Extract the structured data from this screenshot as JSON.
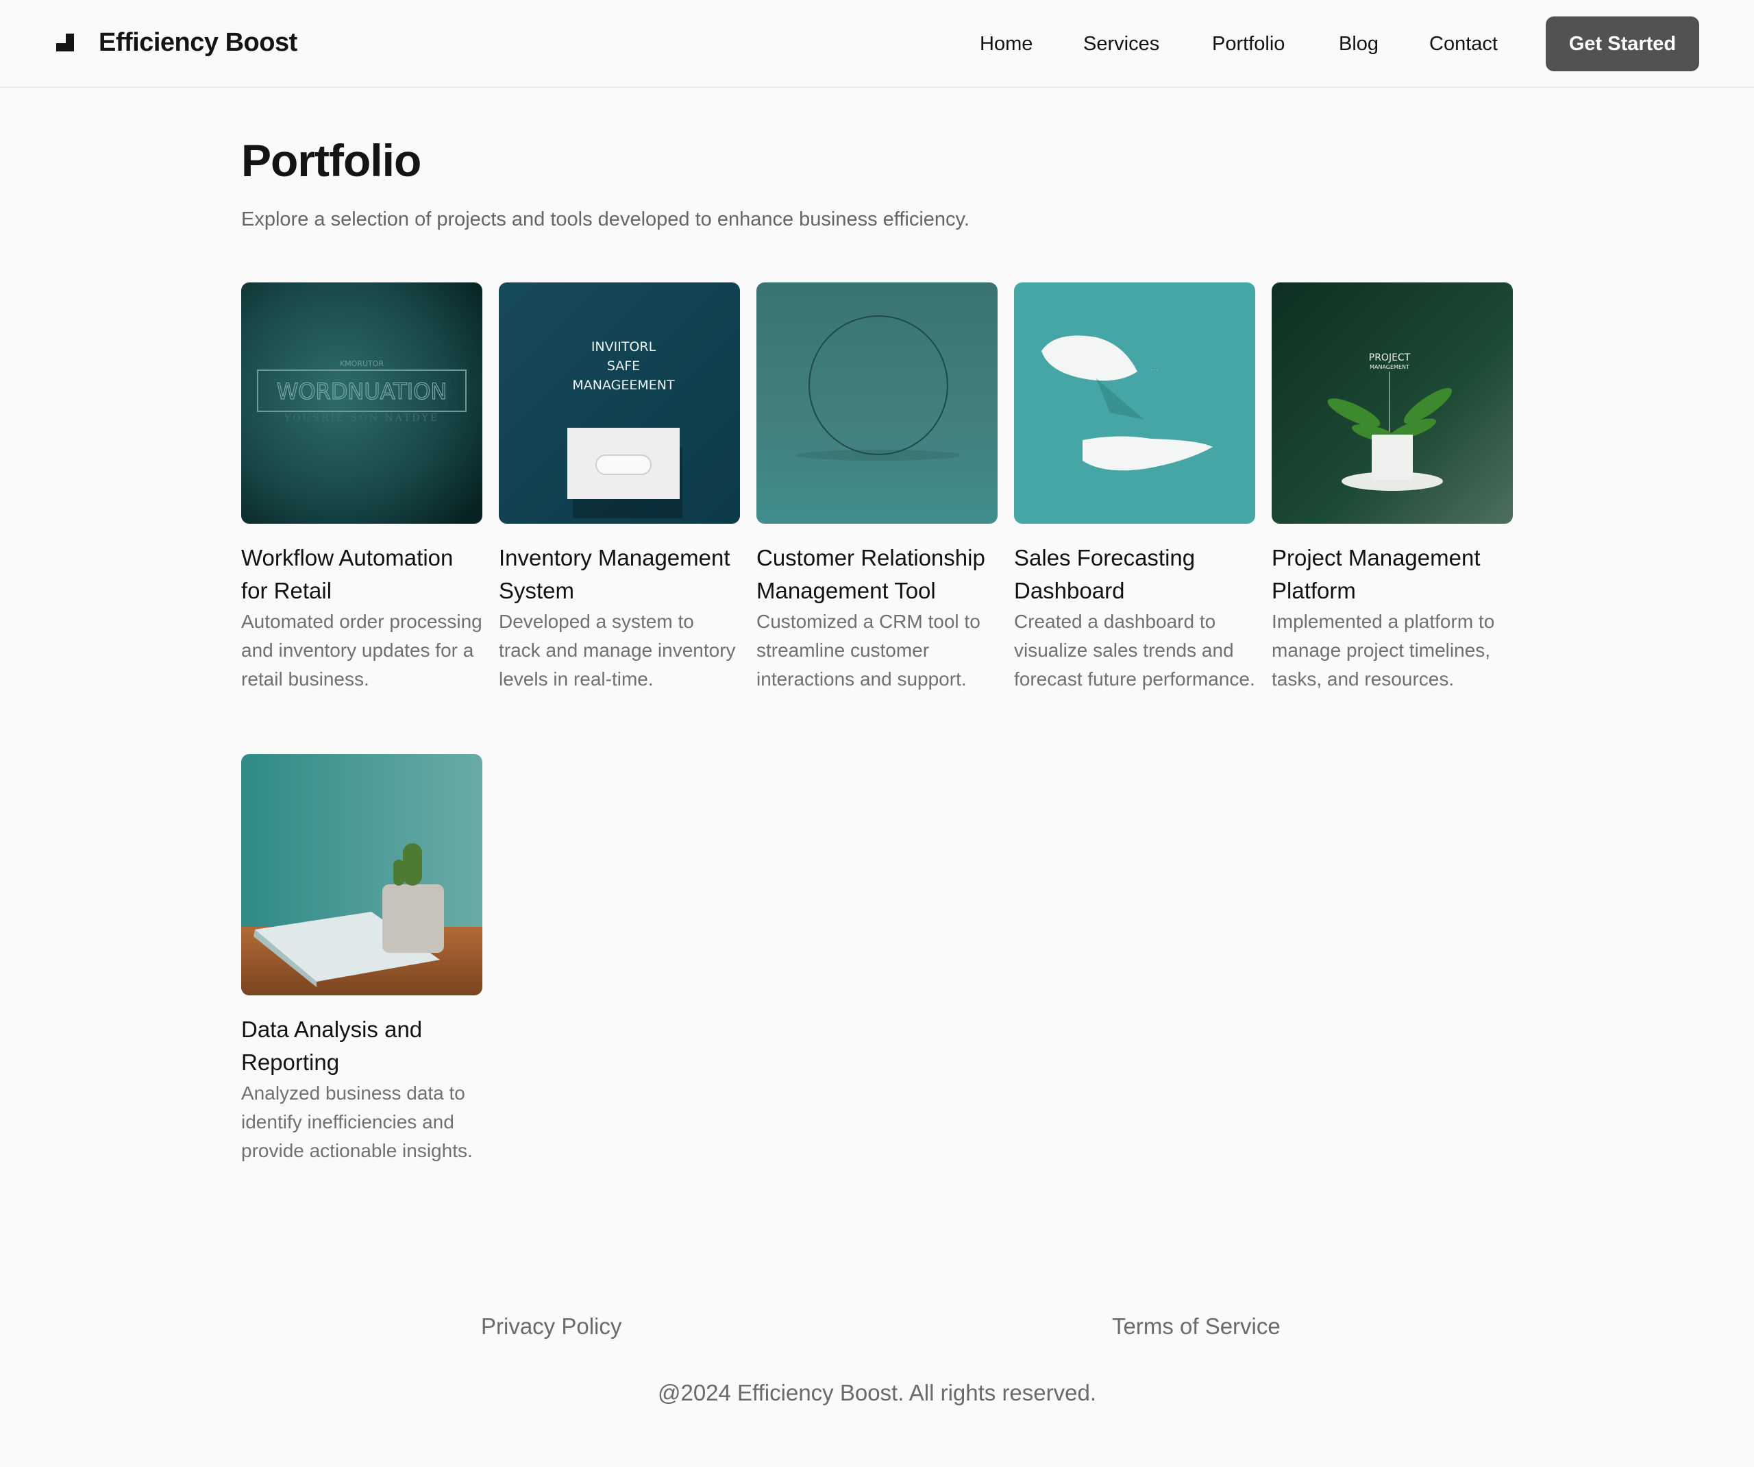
{
  "header": {
    "brand_name": "Efficiency Boost",
    "brand_icon": "stairs-logo-icon",
    "nav": [
      "Home",
      "Services",
      "Portfolio",
      "Blog",
      "Contact"
    ],
    "cta_label": "Get Started"
  },
  "main": {
    "title": "Portfolio",
    "subtitle": "Explore a selection of projects and tools developed to enhance business efficiency."
  },
  "projects": [
    {
      "title": "Workflow Automation for Retail",
      "description": "Automated order processing and inventory updates for a retail business.",
      "image_text": [
        "KMORUTOR",
        "WORDNUATION",
        "YOUSRIE SON NATDYE"
      ]
    },
    {
      "title": "Inventory Management System",
      "description": "Developed a system to track and manage inventory levels in real-time.",
      "image_text": [
        "INVIITORL",
        "SAFE",
        "MANAGEEMENT"
      ]
    },
    {
      "title": "Customer Relationship Management Tool",
      "description": "Customized a CRM tool to streamline customer interactions and support.",
      "image_text": []
    },
    {
      "title": "Sales Forecasting Dashboard",
      "description": "Created a dashboard to visualize sales trends and forecast future performance.",
      "image_text": []
    },
    {
      "title": "Project Management Platform",
      "description": "Implemented a platform to manage project timelines, tasks, and resources.",
      "image_text": [
        "PROJECT",
        "MANAGEMENT"
      ]
    },
    {
      "title": "Data Analysis and Reporting",
      "description": "Analyzed business data to identify inefficiencies and provide actionable insights.",
      "image_text": []
    }
  ],
  "footer": {
    "links": [
      "Privacy Policy",
      "Terms of Service"
    ],
    "copyright": "@2024 Efficiency Boost. All rights reserved."
  },
  "colors": {
    "background": "#fafafa",
    "cta": "#525252",
    "teal_dark": "#0f4a5a",
    "teal_mid": "#3f7f7c",
    "teal_bright": "#46a6a6",
    "green_dark": "#17402c"
  }
}
